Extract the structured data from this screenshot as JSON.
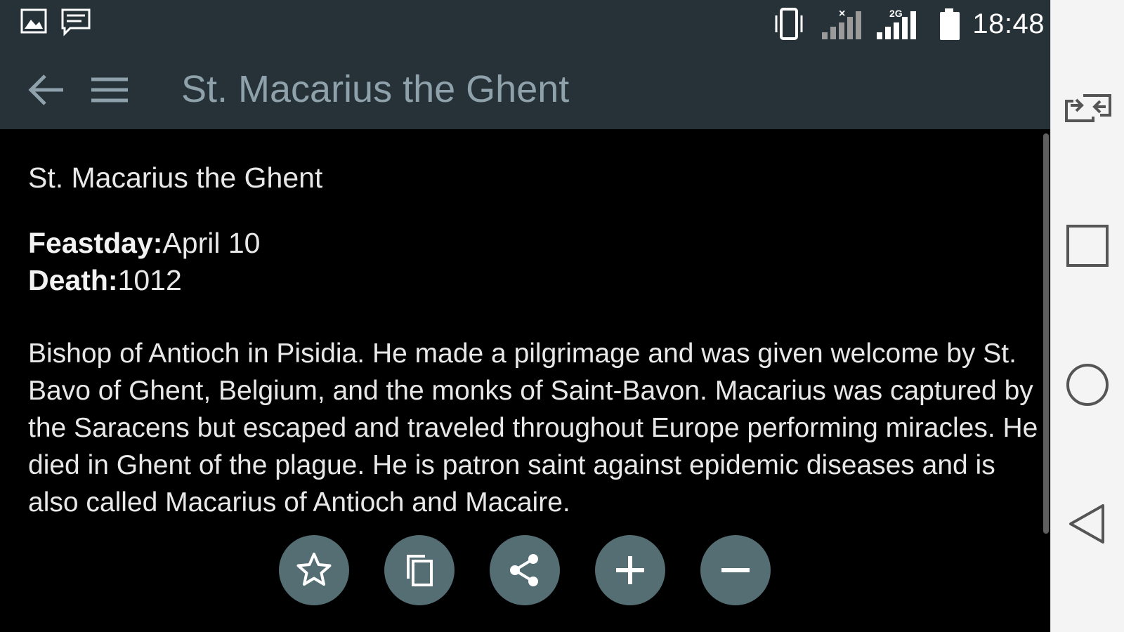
{
  "status_bar": {
    "time": "18:48",
    "icons": [
      "image-icon",
      "message-icon",
      "vibrate-icon",
      "signal-icon-1",
      "signal-icon-2",
      "battery-icon"
    ],
    "network_label": "2G"
  },
  "app_bar": {
    "title": "St. Macarius the Ghent"
  },
  "saint": {
    "name": "St. Macarius the Ghent",
    "feastday_label": "Feastday:",
    "feastday_value": "April 10",
    "death_label": "Death:",
    "death_value": "1012",
    "bio": "Bishop of Antioch in Pisidia. He made a pilgrimage and was given welcome by St. Bavo of Ghent, Belgium, and the monks of Saint-Bavon. Macarius was captured by the Saracens but escaped and traveled throughout Europe performing miracles. He died in Ghent of the plague. He is patron saint against epidemic diseases and is also called Macarius of Antioch and Macaire."
  },
  "actions": [
    "star-icon",
    "copy-icon",
    "share-icon",
    "plus-icon",
    "minus-icon"
  ],
  "nav_bar": [
    "switch-app-icon",
    "recents-icon",
    "home-icon",
    "back-icon"
  ],
  "colors": {
    "app_bar": "#263238",
    "title_text": "#8fa2ab",
    "fab": "#546e73",
    "background": "#000000"
  }
}
